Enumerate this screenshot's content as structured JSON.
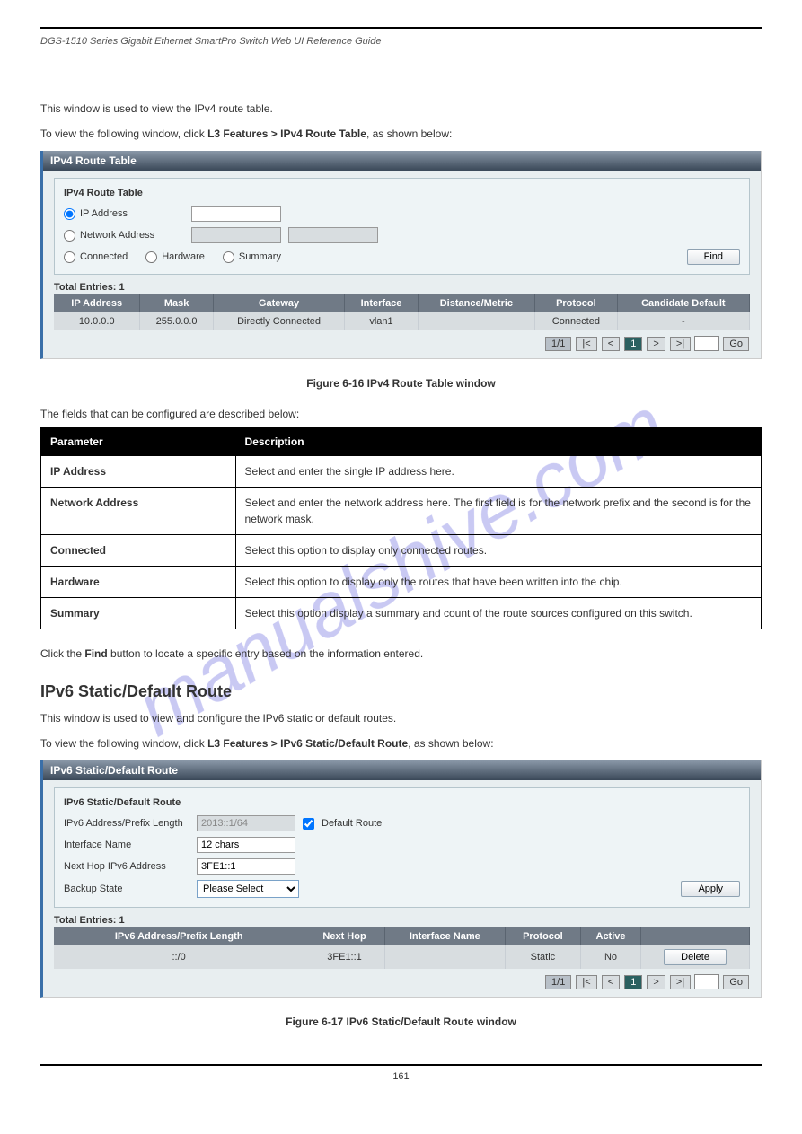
{
  "header": {
    "left": "DGS-1510 Series Gigabit Ethernet SmartPro Switch Web UI Reference Guide",
    "right": ""
  },
  "watermark": "manualshive.com",
  "intro1": {
    "desc": "This window is used to view the IPv4 route table.",
    "nav_prefix": "To view the following window, click ",
    "nav_path": "L3 Features > IPv4 Route Table",
    "nav_suffix": ", as shown below:"
  },
  "panel1": {
    "title": "IPv4 Route Table",
    "legend": "IPv4 Route Table",
    "radios": {
      "ip": "IP Address",
      "net": "Network Address",
      "conn": "Connected",
      "hw": "Hardware",
      "sum": "Summary"
    },
    "find": "Find",
    "total": "Total Entries: 1",
    "cols": [
      "IP Address",
      "Mask",
      "Gateway",
      "Interface",
      "Distance/Metric",
      "Protocol",
      "Candidate Default"
    ],
    "row": [
      "10.0.0.0",
      "255.0.0.0",
      "Directly Connected",
      "vlan1",
      "",
      "Connected",
      "-"
    ],
    "pager": {
      "pages": "1/1",
      "cur": "1",
      "go": "Go"
    }
  },
  "figcap1": "Figure 6-16 IPv4 Route Table window",
  "param_intro": "The fields that can be configured are described below:",
  "param_table": {
    "h1": "Parameter",
    "h2": "Description",
    "rows": [
      [
        "IP Address",
        "Select and enter the single IP address here."
      ],
      [
        "Network Address",
        "Select and enter the network address here. The first field is for the network prefix and the second is for the network mask."
      ],
      [
        "Connected",
        "Select this option to display only connected routes."
      ],
      [
        "Hardware",
        "Select this option to display only the routes that have been written into the chip."
      ],
      [
        "Summary",
        "Select this option display a summary and count of the route sources configured on this switch."
      ]
    ]
  },
  "action1": {
    "prefix": "Click the ",
    "btn": "Find",
    "suffix": " button to locate a specific entry based on the information entered."
  },
  "section2": {
    "title": "IPv6 Static/Default Route",
    "desc": "This window is used to view and configure the IPv6 static or default routes.",
    "nav_prefix": "To view the following window, click ",
    "nav_path": "L3 Features > IPv6 Static/Default Route",
    "nav_suffix": ", as shown below:"
  },
  "panel2": {
    "title": "IPv6 Static/Default Route",
    "legend": "IPv6 Static/Default Route",
    "labels": {
      "addr": "IPv6 Address/Prefix Length",
      "def": "Default Route",
      "if": "Interface Name",
      "nh": "Next Hop IPv6 Address",
      "bk": "Backup State"
    },
    "vals": {
      "addr": "2013::1/64",
      "if": "12 chars",
      "nh": "3FE1::1",
      "bk": "Please Select"
    },
    "apply": "Apply",
    "total": "Total Entries: 1",
    "cols": [
      "IPv6 Address/Prefix Length",
      "Next Hop",
      "Interface Name",
      "Protocol",
      "Active",
      ""
    ],
    "row": [
      "::/0",
      "3FE1::1",
      "",
      "Static",
      "No"
    ],
    "delete": "Delete",
    "pager": {
      "pages": "1/1",
      "cur": "1",
      "go": "Go"
    }
  },
  "figcap2": "Figure 6-17 IPv6 Static/Default Route window",
  "footer": "161"
}
